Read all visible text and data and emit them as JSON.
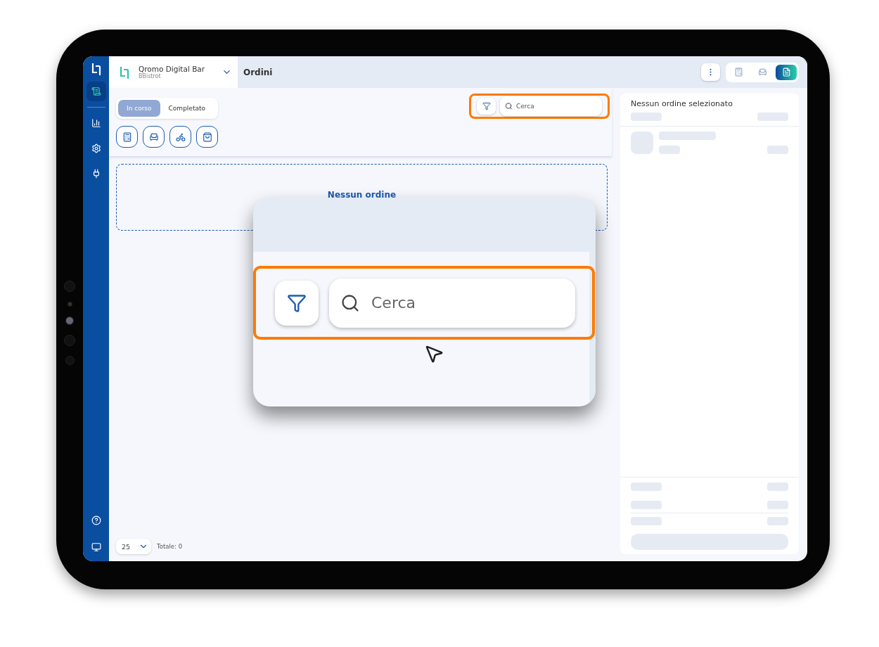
{
  "sidebar": {
    "items": [
      {
        "selected": true
      },
      {
        "selected": false
      },
      {
        "selected": false
      },
      {
        "selected": false
      }
    ],
    "bottom_items": [
      {
        "selected": false
      },
      {
        "selected": false
      }
    ]
  },
  "store": {
    "name": "Qromo Digital Bar",
    "subtitle": "BBistrot"
  },
  "page_title": "Ordini",
  "view_switch": [
    {
      "selected": false
    },
    {
      "selected": false
    },
    {
      "selected": true
    }
  ],
  "status_tabs": [
    {
      "label": "In corso",
      "selected": true
    },
    {
      "label": "Completato",
      "selected": false
    }
  ],
  "search": {
    "placeholder": "Cerca"
  },
  "empty_state": {
    "message": "Nessun ordine"
  },
  "pagination": {
    "page_size": "25",
    "total": "Totale: 0"
  },
  "detail_panel": {
    "title": "Nessun ordine selezionato"
  },
  "zoom_callout": {
    "search": {
      "placeholder": "Cerca"
    }
  }
}
